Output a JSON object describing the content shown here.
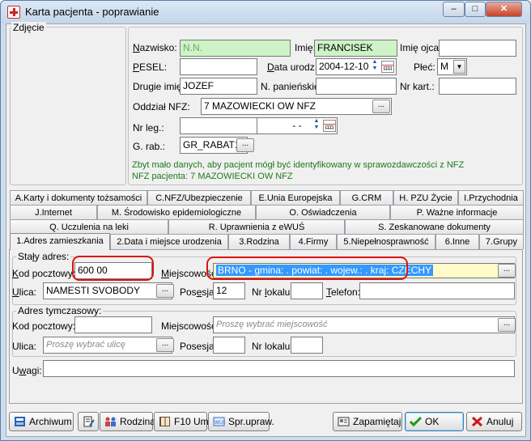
{
  "window": {
    "title": "Karta pacjenta - poprawianie",
    "minimize_glyph": "–",
    "maximize_glyph": "□",
    "close_glyph": "✕"
  },
  "photo": {
    "title": "Zdjęcie"
  },
  "patient": {
    "nazwisko_label": "Nazwisko:",
    "nazwisko_value": "N.N.",
    "imie_label": "Imię:",
    "imie_value": "FRANCISEK",
    "imie_ojca_label": "Imię ojca:",
    "imie_ojca_value": "",
    "pesel_label": "PESEL:",
    "pesel_value": "",
    "data_urodz_label": "Data urodz.:",
    "data_urodz_value": "2004-12-10",
    "plec_label": "Płeć:",
    "plec_value": "M",
    "drugie_imie_label": "Drugie imię:",
    "drugie_imie_value": "JOZEF",
    "n_panienskie_label": "N. panieńskie:",
    "n_panienskie_value": "",
    "nr_kart_label": "Nr kart.:",
    "nr_kart_value": "",
    "oddzial_nfz_label": "Oddział NFZ:",
    "oddzial_nfz_value": "7 MAZOWIECKI OW NFZ",
    "nr_leg_label": "Nr leg.:",
    "nr_leg_value": "",
    "nr_leg_date_value": "- -",
    "g_rab_label": "G. rab.:",
    "g_rab_value": "GR_RABAT1"
  },
  "messages": {
    "warning": "Zbyt mało danych, aby pacjent mógł być identyfikowany w sprawozdawczości z NFZ",
    "nfz_info": "NFZ pacjenta: 7 MAZOWIECKI OW NFZ"
  },
  "tabs": {
    "row1": [
      "A.Karty i dokumenty tożsamości",
      "C.NFZ/Ubezpieczenie",
      "E.Unia Europejska",
      "G.CRM",
      "H. PZU Życie",
      "I.Przychodnia"
    ],
    "row2": [
      "J.Internet",
      "M. Środowisko epidemiologiczne",
      "O. Oświadczenia",
      "P. Ważne informacje"
    ],
    "row3": [
      "Q. Uczulenia na leki",
      "R. Uprawnienia z eWUŚ",
      "S. Zeskanowane dokumenty"
    ],
    "row4": [
      "1.Adres zamieszkania",
      "2.Data i miejsce urodzenia",
      "3.Rodzina",
      "4.Firmy",
      "5.Niepełnosprawność",
      "6.Inne",
      "7.Grupy"
    ]
  },
  "staly": {
    "title": "Stały adres:",
    "kod_label": "Kod pocztowy:",
    "kod_value": "600 00",
    "miejscowosc_label": "Miejscowość:",
    "miejscowosc_value": "BRNO - gmina: . powiat: . wojew.: . kraj: CZECHY",
    "ulica_label": "Ulica:",
    "ulica_value": "NAMESTI SVOBODY",
    "posesja_label": "Posesja:",
    "posesja_value": "12",
    "nr_lokalu_label": "Nr lokalu:",
    "nr_lokalu_value": "",
    "telefon_label": "Telefon:",
    "telefon_value": ""
  },
  "tymczasowy": {
    "title": "Adres tymczasowy:",
    "kod_label": "Kod pocztowy:",
    "kod_value": "",
    "miejscowosc_label": "Miejscowość:",
    "miejscowosc_placeholder": "Proszę wybrać miejscowość",
    "ulica_label": "Ulica:",
    "ulica_placeholder": "Proszę wybrać ulicę",
    "posesja_label": "Posesja:",
    "posesja_value": "",
    "nr_lokalu_label": "Nr lokalu:",
    "nr_lokalu_value": ""
  },
  "uwagi": {
    "label": "Uwagi:",
    "value": ""
  },
  "buttons": {
    "archiwum": "Archiwum",
    "rodzina": "Rodzina",
    "f10": "F10 Um.",
    "spr": "Spr.upraw.",
    "zapamietaj": "Zapamiętaj",
    "ok": "OK",
    "anuluj": "Anuluj",
    "ellipsis": "..."
  },
  "colors": {
    "required_field": "#cdf3c6",
    "selected_field": "#fffbc8",
    "highlight_circle": "#e01010",
    "info_text": "#1b7a1b"
  }
}
